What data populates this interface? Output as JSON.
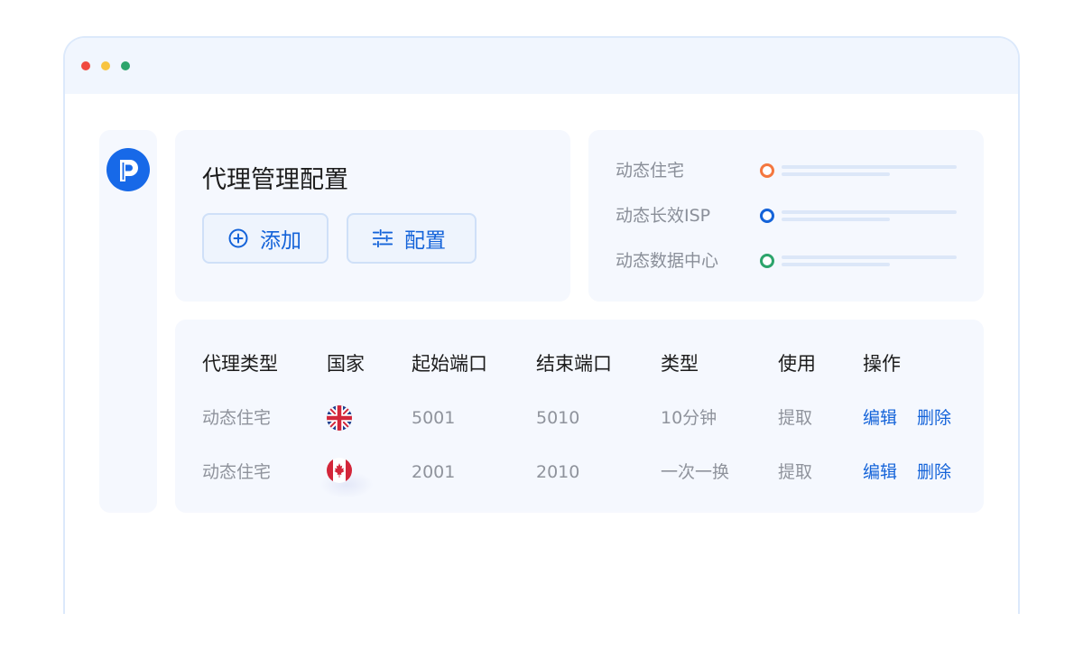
{
  "window": {
    "dots": [
      "#f0493e",
      "#f8c440",
      "#2ca46b"
    ]
  },
  "sidebar": {
    "logo_icon": "brand-logo-icon"
  },
  "main": {
    "title": "代理管理配置",
    "buttons": {
      "add_label": "添加",
      "add_icon": "plus-circle-icon",
      "config_label": "配置",
      "config_icon": "sliders-icon"
    }
  },
  "legend": {
    "items": [
      {
        "label": "动态住宅",
        "color": "#f4773e"
      },
      {
        "label": "动态长效ISP",
        "color": "#1463d9"
      },
      {
        "label": "动态数据中心",
        "color": "#2ca46b"
      }
    ]
  },
  "table": {
    "headers": [
      "代理类型",
      "国家",
      "起始端口",
      "结束端口",
      "类型",
      "使用",
      "操作"
    ],
    "rows": [
      {
        "proxy_type": "动态住宅",
        "country_flag": "uk-flag-icon",
        "start_port": "5001",
        "end_port": "5010",
        "type": "10分钟",
        "usage": "提取",
        "edit": "编辑",
        "delete": "删除"
      },
      {
        "proxy_type": "动态住宅",
        "country_flag": "canada-flag-icon",
        "start_port": "2001",
        "end_port": "2010",
        "type": "一次一换",
        "usage": "提取",
        "edit": "编辑",
        "delete": "删除"
      }
    ]
  }
}
